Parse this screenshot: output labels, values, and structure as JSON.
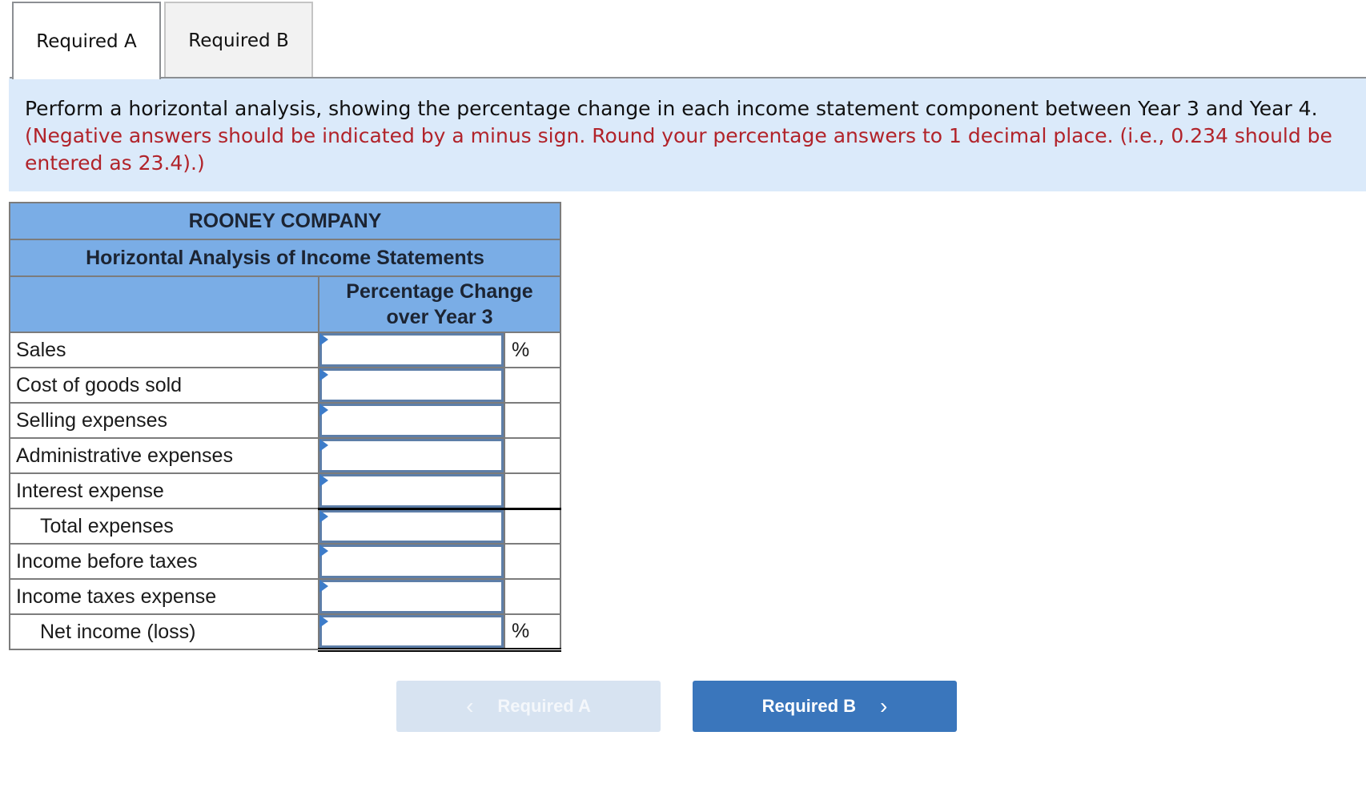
{
  "tabs": [
    {
      "label": "Required A",
      "active": true
    },
    {
      "label": "Required B",
      "active": false
    }
  ],
  "instructions": {
    "main": "Perform a horizontal analysis, showing the percentage change in each income statement component between Year 3 and Year 4.",
    "note": "(Negative answers should be indicated by a minus sign. Round your percentage answers to 1 decimal place. (i.e., 0.234 should be entered as 23.4).)"
  },
  "table": {
    "company": "ROONEY COMPANY",
    "title": "Horizontal Analysis of Income Statements",
    "column_header": "Percentage Change over Year 3",
    "column_header_line1": "Percentage Change",
    "column_header_line2": "over Year 3",
    "rows": [
      {
        "label": "Sales",
        "value": "",
        "suffix": "%"
      },
      {
        "label": "Cost of goods sold",
        "value": "",
        "suffix": ""
      },
      {
        "label": "Selling expenses",
        "value": "",
        "suffix": ""
      },
      {
        "label": "Administrative expenses",
        "value": "",
        "suffix": ""
      },
      {
        "label": "Interest expense",
        "value": "",
        "suffix": ""
      },
      {
        "label": "Total expenses",
        "value": "",
        "suffix": ""
      },
      {
        "label": "Income before taxes",
        "value": "",
        "suffix": ""
      },
      {
        "label": "Income taxes expense",
        "value": "",
        "suffix": ""
      },
      {
        "label": "Net income (loss)",
        "value": "",
        "suffix": "%"
      }
    ]
  },
  "navigation": {
    "prev_label": "Required A",
    "next_label": "Required B",
    "prev_icon": "chevron-left-icon",
    "next_icon": "chevron-right-icon",
    "prev_disabled": true
  },
  "colors": {
    "header_bg": "#7aade6",
    "instruction_bg": "#dbeafa",
    "note_text": "#b1232a",
    "primary_button": "#3a76bc",
    "disabled_button": "#d7e3f1",
    "input_flag": "#3d7cc9"
  }
}
